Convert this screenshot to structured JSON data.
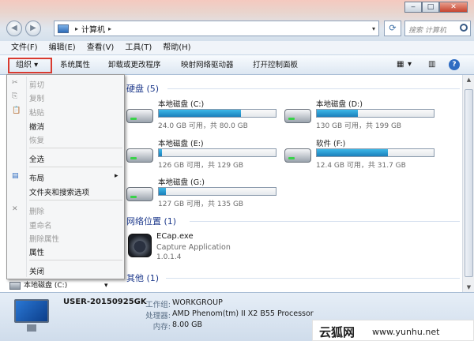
{
  "window": {
    "min_label": "‒",
    "max_label": "□",
    "close_label": "✕"
  },
  "nav": {
    "back_label": "◀",
    "forward_label": "▶"
  },
  "address": {
    "location": "计算机",
    "sep_glyph": "▸"
  },
  "search": {
    "placeholder": "搜索 计算机"
  },
  "menubar": {
    "items": [
      "文件(F)",
      "编辑(E)",
      "查看(V)",
      "工具(T)",
      "帮助(H)"
    ]
  },
  "cmdbar": {
    "organize": "组织 ▾",
    "items": [
      "系统属性",
      "卸载或更改程序",
      "映射网络驱动器",
      "打开控制面板"
    ],
    "view_icon": "▦",
    "view_drop": "▾",
    "pane_icon": "▥",
    "help": "?"
  },
  "groups": {
    "hdd": "硬盘 (5)",
    "network": "网络位置 (1)",
    "other": "其他 (1)"
  },
  "drives": [
    {
      "name": "本地磁盘 (C:)",
      "info": "24.0 GB 可用，共 80.0 GB",
      "used": 0.7
    },
    {
      "name": "本地磁盘 (D:)",
      "info": "130 GB 可用，共 199 GB",
      "used": 0.35
    },
    {
      "name": "本地磁盘 (E:)",
      "info": "126 GB 可用，共 129 GB",
      "used": 0.03
    },
    {
      "name": "软件 (F:)",
      "info": "12.4 GB 可用，共 31.7 GB",
      "used": 0.61
    },
    {
      "name": "本地磁盘 (G:)",
      "info": "127 GB 可用，共 135 GB",
      "used": 0.06
    }
  ],
  "network_app": {
    "name": "ECap.exe",
    "desc": "Capture Application",
    "version": "1.0.1.4"
  },
  "context_menu": {
    "items": [
      {
        "label": "剪切",
        "enabled": false,
        "icon": "✂"
      },
      {
        "label": "复制",
        "enabled": false,
        "icon": "⎘"
      },
      {
        "label": "粘贴",
        "enabled": false,
        "icon": "📋"
      },
      {
        "label": "撤消",
        "enabled": true
      },
      {
        "label": "恢复",
        "enabled": false
      },
      {
        "label": "全选",
        "enabled": true
      },
      {
        "label": "布局",
        "enabled": true,
        "submenu": "▸",
        "icon": "▤"
      },
      {
        "label": "文件夹和搜索选项",
        "enabled": true
      },
      {
        "label": "删除",
        "enabled": false,
        "icon": "✕"
      },
      {
        "label": "重命名",
        "enabled": false
      },
      {
        "label": "删除属性",
        "enabled": false
      },
      {
        "label": "属性",
        "enabled": true
      },
      {
        "label": "关闭",
        "enabled": true
      }
    ]
  },
  "left_status": {
    "label": "本地磁盘 (C:)",
    "arrow": "▾"
  },
  "details": {
    "pc_name": "USER-20150925GK",
    "workgroup_label": "工作组:",
    "workgroup_value": "WORKGROUP",
    "cpu_label": "处理器:",
    "cpu_value": "AMD Phenom(tm) II X2 B55 Processor",
    "mem_label": "内存:",
    "mem_value": "8.00 GB"
  },
  "watermark": {
    "brand": "云狐网",
    "url": "www.yunhu.net"
  },
  "colors": {
    "accent": "#1e3a8c",
    "highlight_box": "#d93a2f",
    "drive_fill": "#1b7fba"
  }
}
